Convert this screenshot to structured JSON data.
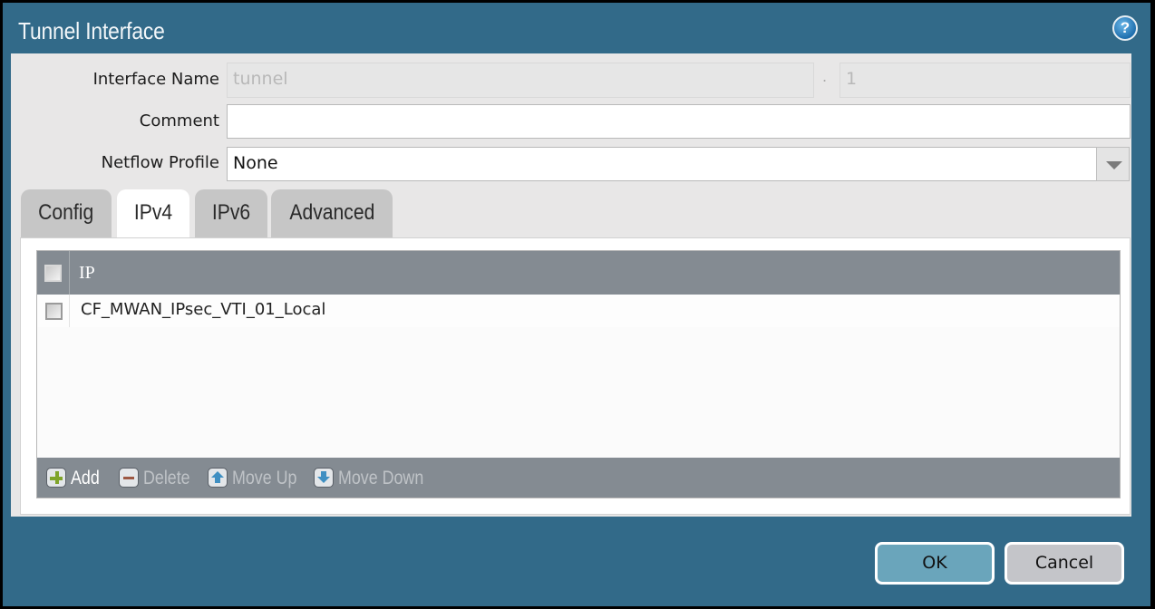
{
  "dialog": {
    "title": "Tunnel Interface",
    "help_icon": "?"
  },
  "form": {
    "interface_name": {
      "label": "Interface Name",
      "value": "tunnel",
      "separator": ".",
      "suffix": "1"
    },
    "comment": {
      "label": "Comment",
      "value": ""
    },
    "netflow_profile": {
      "label": "Netflow Profile",
      "value": "None"
    }
  },
  "tabs": [
    {
      "label": "Config",
      "active": false
    },
    {
      "label": "IPv4",
      "active": true
    },
    {
      "label": "IPv6",
      "active": false
    },
    {
      "label": "Advanced",
      "active": false
    }
  ],
  "ip_table": {
    "header": "IP",
    "rows": [
      {
        "ip": "CF_MWAN_IPsec_VTI_01_Local",
        "checked": false
      }
    ]
  },
  "toolbar": {
    "add": "Add",
    "delete": "Delete",
    "move_up": "Move Up",
    "move_down": "Move Down"
  },
  "buttons": {
    "ok": "OK",
    "cancel": "Cancel"
  },
  "colors": {
    "titlebar": "#326a89",
    "ok_button": "#6aa5bb",
    "cancel_button": "#c4c5c9",
    "grid_header": "#848b92"
  }
}
